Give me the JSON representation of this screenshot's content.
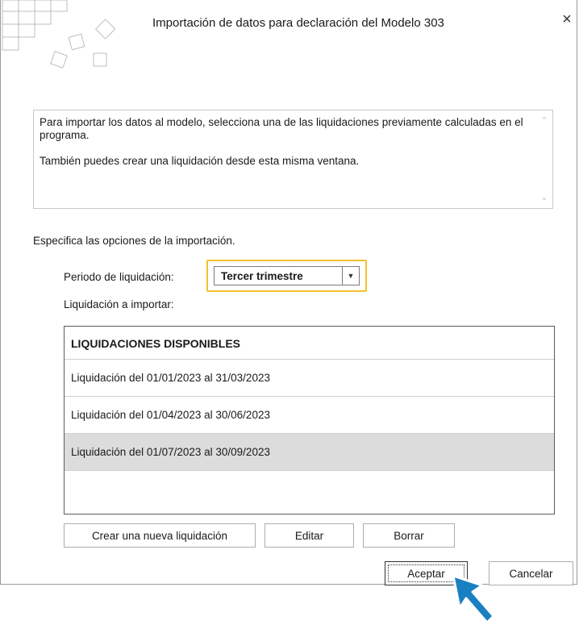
{
  "dialog": {
    "title": "Importación de datos para declaración del Modelo 303",
    "close_glyph": "×",
    "info": {
      "line1": "Para importar los datos al modelo, selecciona una de las liquidaciones previamente calculadas en el programa.",
      "line2": "También puedes crear una liquidación desde esta misma ventana."
    },
    "options_label": "Especifica las opciones de la importación.",
    "period": {
      "label": "Periodo de liquidación:",
      "selected": "Tercer trimestre"
    },
    "import_label": "Liquidación a importar:",
    "list": {
      "header": "LIQUIDACIONES DISPONIBLES",
      "rows": [
        "Liquidación del 01/01/2023 al 31/03/2023",
        "Liquidación del 01/04/2023 al 30/06/2023",
        "Liquidación del 01/07/2023 al 30/09/2023"
      ],
      "selected_index": 2
    },
    "buttons": {
      "create": "Crear una nueva liquidación",
      "edit": "Editar",
      "delete": "Borrar",
      "accept": "Aceptar",
      "cancel": "Cancelar"
    }
  },
  "colors": {
    "highlight_border": "#f2c12e",
    "selected_row": "#dcdcdc",
    "cursor": "#1a7fc1"
  }
}
